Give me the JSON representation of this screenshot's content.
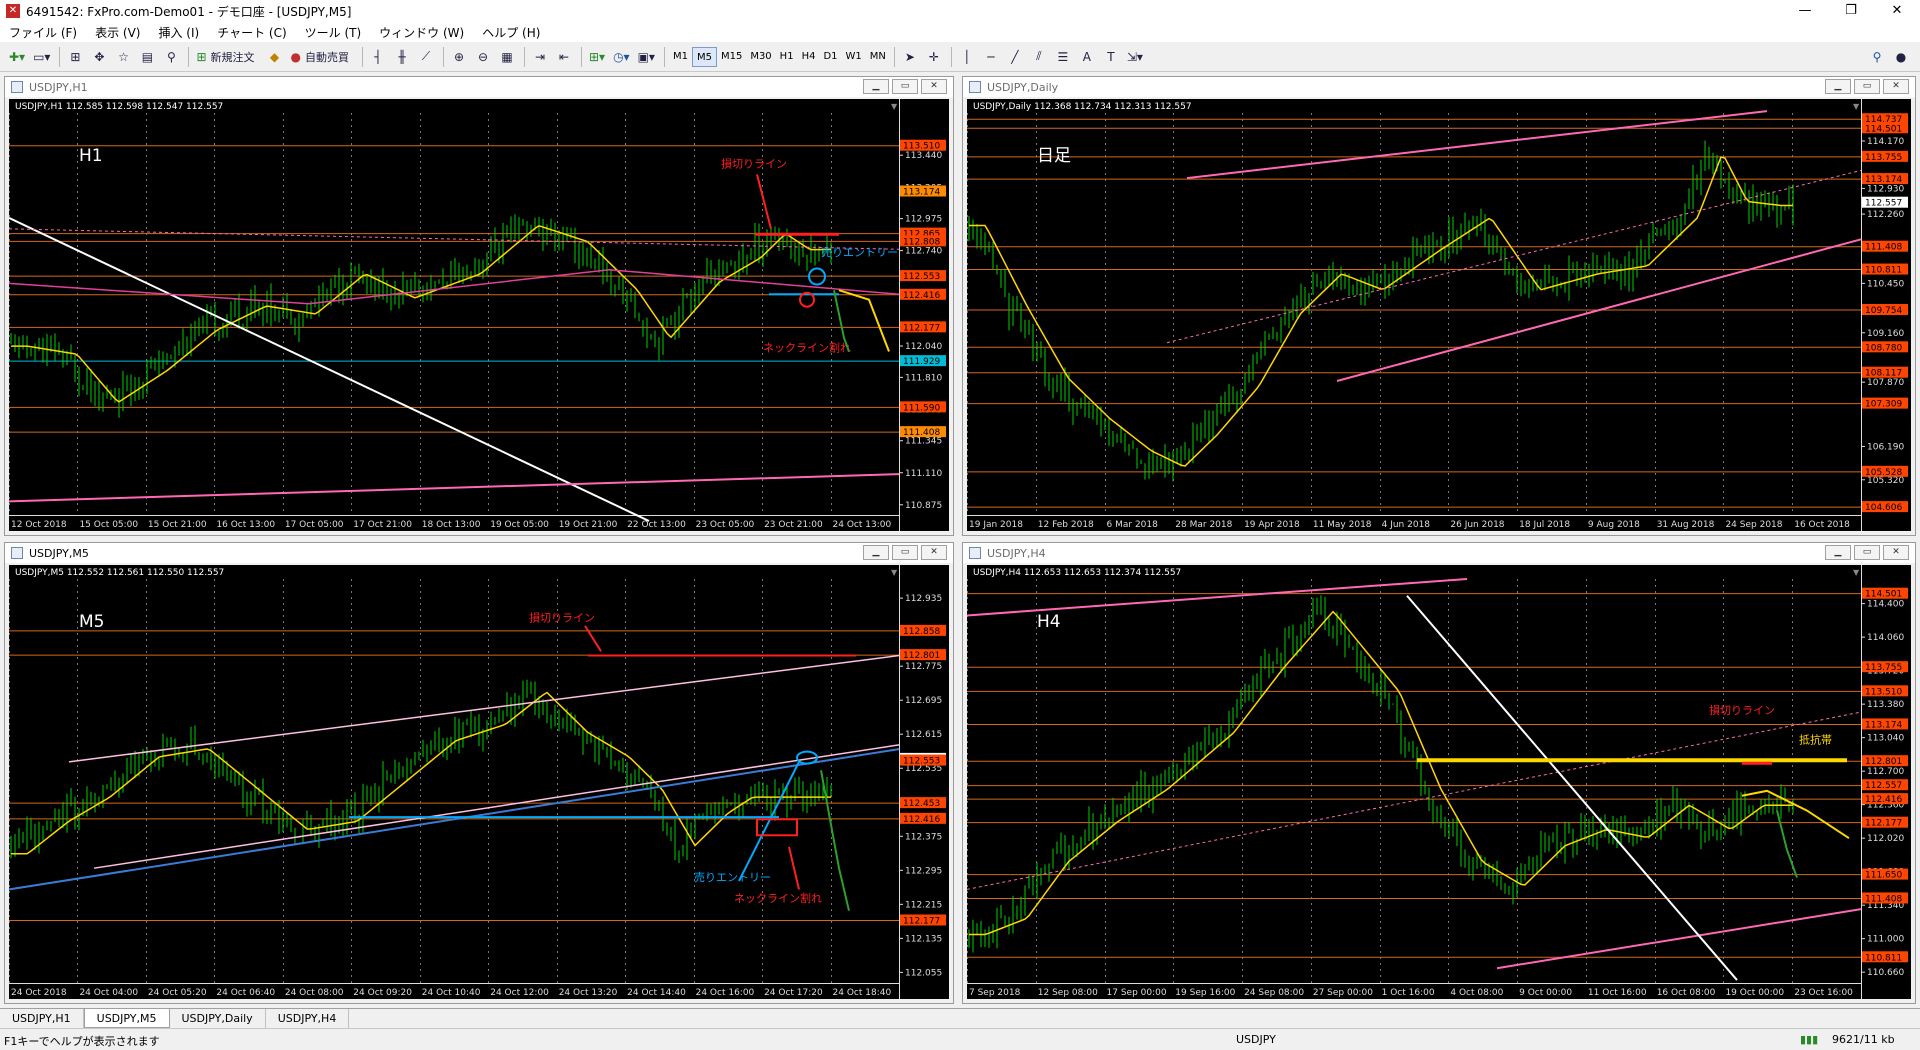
{
  "app": {
    "title": "6491542: FxPro.com-Demo01 - デモ口座 - [USDJPY,M5]",
    "icon": "mt4-icon"
  },
  "window_buttons": [
    "—",
    "❐",
    "✕"
  ],
  "menu": [
    "ファイル (F)",
    "表示 (V)",
    "挿入 (I)",
    "チャート (C)",
    "ツール (T)",
    "ウィンドウ (W)",
    "ヘルプ (H)"
  ],
  "toolbar": {
    "new_order": "新規注文",
    "auto_trade": "自動売買",
    "timeframes": [
      "M1",
      "M5",
      "M15",
      "M30",
      "H1",
      "H4",
      "D1",
      "W1",
      "MN"
    ],
    "active_tf": "M5"
  },
  "colors": {
    "bg": "#000000",
    "candle": "#00d000",
    "hline": "#d2691e",
    "ma": "#ffd700",
    "pink": "#ff69b4",
    "red": "#ff2020",
    "cyan": "#00aaff",
    "green": "#2ca02c"
  },
  "charts": [
    {
      "id": "h1",
      "window_title": "USDJPY,H1",
      "info": "USDJPY,H1  112.585 112.598 112.547 112.557",
      "label": "H1",
      "ymin": 110.8,
      "ymax": 113.75,
      "levels": [
        113.51,
        112.865,
        112.808,
        112.553,
        112.416,
        112.177,
        111.59,
        111.408
      ],
      "cyan_level": 111.929,
      "boxes": [
        {
          "v": 113.51,
          "t": "113.510"
        },
        {
          "v": 113.174,
          "t": "113.174",
          "c": "#ff8c00"
        },
        {
          "v": 112.865,
          "t": "112.865"
        },
        {
          "v": 112.808,
          "t": "112.808"
        },
        {
          "v": 112.553,
          "t": "112.553"
        },
        {
          "v": 112.416,
          "t": "112.416"
        },
        {
          "v": 112.177,
          "t": "112.177"
        },
        {
          "v": 111.929,
          "t": "111.929",
          "c": "#00bcd4"
        },
        {
          "v": 111.59,
          "t": "111.590"
        },
        {
          "v": 111.408,
          "t": "111.408",
          "c": "#ff8c00"
        }
      ],
      "ticks": [
        {
          "v": 113.44,
          "t": "113.440"
        },
        {
          "v": 113.205,
          "t": "113.205"
        },
        {
          "v": 112.975,
          "t": "112.975"
        },
        {
          "v": 112.74,
          "t": "112.740"
        },
        {
          "v": 112.04,
          "t": "112.040"
        },
        {
          "v": 111.81,
          "t": "111.810"
        },
        {
          "v": 111.575,
          "t": "111.575"
        },
        {
          "v": 111.345,
          "t": "111.345"
        },
        {
          "v": 111.11,
          "t": "111.110"
        },
        {
          "v": 110.875,
          "t": "110.875"
        }
      ],
      "xlabels": [
        "12 Oct 2018",
        "15 Oct 05:00",
        "15 Oct 21:00",
        "16 Oct 13:00",
        "17 Oct 05:00",
        "17 Oct 21:00",
        "18 Oct 13:00",
        "19 Oct 05:00",
        "19 Oct 21:00",
        "22 Oct 13:00",
        "23 Oct 05:00",
        "23 Oct 21:00",
        "24 Oct 13:00"
      ],
      "annotations": [
        {
          "t": "損切りライン",
          "c": "#ff2020"
        },
        {
          "t": "売りエントリー",
          "c": "#00aaff"
        },
        {
          "t": "ネックライン割れ",
          "c": "#ff2020"
        }
      ]
    },
    {
      "id": "daily",
      "window_title": "USDJPY,Daily",
      "info": "USDJPY,Daily  112.368 112.734 112.313 112.557",
      "label": "日足",
      "ymin": 104.4,
      "ymax": 114.9,
      "levels": [
        114.737,
        114.501,
        113.755,
        113.174,
        111.408,
        110.811,
        109.754,
        108.78,
        108.117,
        107.309,
        105.528,
        104.606
      ],
      "boxes": [
        {
          "v": 114.737,
          "t": "114.737"
        },
        {
          "v": 114.501,
          "t": "114.501"
        },
        {
          "v": 113.755,
          "t": "113.755"
        },
        {
          "v": 113.174,
          "t": "113.174"
        },
        {
          "v": 112.557,
          "t": "112.557",
          "c": "#ffffff"
        },
        {
          "v": 111.408,
          "t": "111.408"
        },
        {
          "v": 110.811,
          "t": "110.811"
        },
        {
          "v": 109.754,
          "t": "109.754"
        },
        {
          "v": 108.78,
          "t": "108.780"
        },
        {
          "v": 108.117,
          "t": "108.117"
        },
        {
          "v": 107.309,
          "t": "107.309"
        },
        {
          "v": 105.528,
          "t": "105.528"
        },
        {
          "v": 104.606,
          "t": "104.606"
        }
      ],
      "ticks": [
        {
          "v": 114.17,
          "t": "114.170"
        },
        {
          "v": 112.93,
          "t": "112.930"
        },
        {
          "v": 112.26,
          "t": "112.260"
        },
        {
          "v": 110.45,
          "t": "110.450"
        },
        {
          "v": 109.16,
          "t": "109.160"
        },
        {
          "v": 107.87,
          "t": "107.870"
        },
        {
          "v": 106.19,
          "t": "106.190"
        },
        {
          "v": 105.32,
          "t": "105.320"
        }
      ],
      "xlabels": [
        "19 Jan 2018",
        "12 Feb 2018",
        "6 Mar 2018",
        "28 Mar 2018",
        "19 Apr 2018",
        "11 May 2018",
        "4 Jun 2018",
        "26 Jun 2018",
        "18 Jul 2018",
        "9 Aug 2018",
        "31 Aug 2018",
        "24 Sep 2018",
        "16 Oct 2018"
      ],
      "annotations": []
    },
    {
      "id": "m5",
      "window_title": "USDJPY,M5",
      "info": "USDJPY,M5  112.552 112.561 112.550 112.557",
      "label": "M5",
      "ymin": 112.03,
      "ymax": 112.98,
      "levels": [
        112.858,
        112.801,
        112.453,
        112.416,
        112.177
      ],
      "boxes": [
        {
          "v": 112.858,
          "t": "112.858"
        },
        {
          "v": 112.801,
          "t": "112.801"
        },
        {
          "v": 112.557,
          "t": "112.557",
          "c": "#ffffff"
        },
        {
          "v": 112.553,
          "t": "112.553"
        },
        {
          "v": 112.453,
          "t": "112.453"
        },
        {
          "v": 112.416,
          "t": "112.416"
        },
        {
          "v": 112.177,
          "t": "112.177"
        }
      ],
      "ticks": [
        {
          "v": 112.935,
          "t": "112.935"
        },
        {
          "v": 112.775,
          "t": "112.775"
        },
        {
          "v": 112.695,
          "t": "112.695"
        },
        {
          "v": 112.615,
          "t": "112.615"
        },
        {
          "v": 112.535,
          "t": "112.535"
        },
        {
          "v": 112.375,
          "t": "112.375"
        },
        {
          "v": 112.295,
          "t": "112.295"
        },
        {
          "v": 112.215,
          "t": "112.215"
        },
        {
          "v": 112.135,
          "t": "112.135"
        },
        {
          "v": 112.055,
          "t": "112.055"
        }
      ],
      "xlabels": [
        "24 Oct 2018",
        "24 Oct 04:00",
        "24 Oct 05:20",
        "24 Oct 06:40",
        "24 Oct 08:00",
        "24 Oct 09:20",
        "24 Oct 10:40",
        "24 Oct 12:00",
        "24 Oct 13:20",
        "24 Oct 14:40",
        "24 Oct 16:00",
        "24 Oct 17:20",
        "24 Oct 18:40"
      ],
      "annotations": [
        {
          "t": "損切りライン",
          "c": "#ff2020"
        },
        {
          "t": "売りエントリー",
          "c": "#00aaff"
        },
        {
          "t": "ネックライン割れ",
          "c": "#ff2020"
        }
      ]
    },
    {
      "id": "h4",
      "window_title": "USDJPY,H4",
      "info": "USDJPY,H4  112.653 112.653 112.374 112.557",
      "label": "H4",
      "ymin": 110.55,
      "ymax": 114.65,
      "levels": [
        114.501,
        113.755,
        113.51,
        113.174,
        112.801,
        112.553,
        112.416,
        112.177,
        111.65,
        111.408,
        110.811
      ],
      "boxes": [
        {
          "v": 114.501,
          "t": "114.501"
        },
        {
          "v": 113.755,
          "t": "113.755"
        },
        {
          "v": 113.51,
          "t": "113.510"
        },
        {
          "v": 113.174,
          "t": "113.174"
        },
        {
          "v": 112.801,
          "t": "112.801"
        },
        {
          "v": 112.557,
          "t": "112.557"
        },
        {
          "v": 112.416,
          "t": "112.416"
        },
        {
          "v": 112.177,
          "t": "112.177"
        },
        {
          "v": 111.65,
          "t": "111.650"
        },
        {
          "v": 111.408,
          "t": "111.408"
        },
        {
          "v": 110.811,
          "t": "110.811"
        }
      ],
      "ticks": [
        {
          "v": 114.4,
          "t": "114.400"
        },
        {
          "v": 114.06,
          "t": "114.060"
        },
        {
          "v": 113.72,
          "t": "113.720"
        },
        {
          "v": 113.38,
          "t": "113.380"
        },
        {
          "v": 113.04,
          "t": "113.040"
        },
        {
          "v": 112.7,
          "t": "112.700"
        },
        {
          "v": 112.36,
          "t": "112.360"
        },
        {
          "v": 112.02,
          "t": "112.020"
        },
        {
          "v": 111.68,
          "t": "111.680"
        },
        {
          "v": 111.34,
          "t": "111.340"
        },
        {
          "v": 111.0,
          "t": "111.000"
        },
        {
          "v": 110.66,
          "t": "110.660"
        }
      ],
      "xlabels": [
        "7 Sep 2018",
        "12 Sep 08:00",
        "17 Sep 00:00",
        "19 Sep 16:00",
        "24 Sep 08:00",
        "27 Sep 00:00",
        "1 Oct 16:00",
        "4 Oct 08:00",
        "9 Oct 00:00",
        "11 Oct 16:00",
        "16 Oct 08:00",
        "19 Oct 00:00",
        "23 Oct 16:00"
      ],
      "annotations": [
        {
          "t": "損切りライン",
          "c": "#ff2020"
        },
        {
          "t": "抵抗帯",
          "c": "#ffd700"
        }
      ]
    }
  ],
  "bottom_tabs": [
    "USDJPY,H1",
    "USDJPY,M5",
    "USDJPY,Daily",
    "USDJPY,H4"
  ],
  "active_tab": "USDJPY,M5",
  "status": {
    "help": "F1キーでヘルプが表示されます",
    "symbol": "USDJPY",
    "traffic": "9621/11 kb"
  }
}
